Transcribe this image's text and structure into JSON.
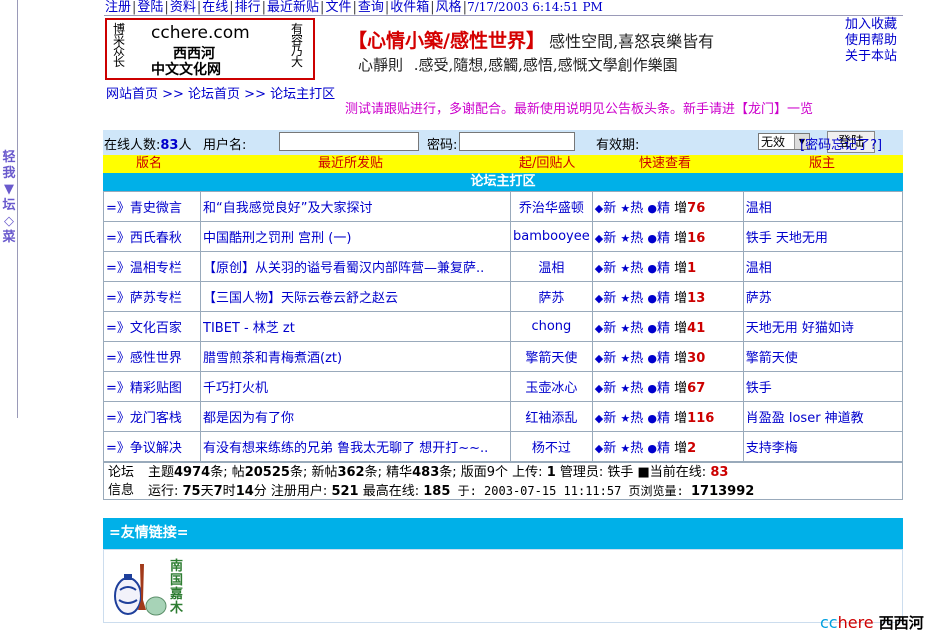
{
  "sidebar": {
    "label": "轻我▼坛◇菜"
  },
  "topnav": {
    "items": [
      "注册",
      "登陆",
      "资料",
      "在线",
      "排行",
      "最近新贴",
      "文件",
      "查询",
      "收件箱",
      "风格"
    ],
    "datetime": "7/17/2003 6:14:51 PM"
  },
  "logo": {
    "left_chars": "博采众长",
    "right_chars": "有容乃大",
    "site": "cchere.com",
    "sub1": "西西河",
    "sub2": "中文文化网"
  },
  "slogan": {
    "title": "【心情小築/感性世界】",
    "line1_rest": "感性空間,喜怒哀樂皆有",
    "line2": "心靜則 .感受,隨想,感觸,感悟,感慨文學創作樂園"
  },
  "right_links": [
    "加入收藏",
    "使用帮助",
    "关于本站"
  ],
  "breadcrumb": "网站首页 >> 论坛首页 >> 论坛主打区",
  "notice": "测试请跟贴进行，多谢配合。最新使用说明见公告板头条。新手请进【龙门】一览",
  "login": {
    "online_prefix": "在线人数:",
    "online_count": "83",
    "online_suffix": "人",
    "username_label": "用户名:",
    "username_value": "",
    "password_label": "密码:",
    "password_value": "",
    "validity_label": "有效期:",
    "validity_value": "无效",
    "submit_label": "登陆",
    "forgot_label": "[密码忘记了?]"
  },
  "columns": [
    "版名",
    "最近所发贴",
    "起/回贴人",
    "快速查看",
    "版主"
  ],
  "section_title": "论坛主打区",
  "quickview": {
    "new": "新",
    "hot": "热",
    "best": "精",
    "inc": "增"
  },
  "forums": [
    {
      "name": "=》青史微言",
      "post": "和“自我感觉良好”及大家探讨",
      "user": "乔治华盛顿",
      "inc": "76",
      "mods": "温相"
    },
    {
      "name": "=》西氏春秋",
      "post": "中国酷刑之罚刑 宫刑 (一)",
      "user": "bambooyee",
      "inc": "16",
      "mods": "铁手 天地无用"
    },
    {
      "name": "=》温相专栏",
      "post": "【原创】从关羽的谥号看蜀汉内部阵营—兼复萨..",
      "user": "温相",
      "inc": "1",
      "mods": "温相"
    },
    {
      "name": "=》萨苏专栏",
      "post": "【三国人物】天际云卷云舒之赵云",
      "user": "萨苏",
      "inc": "13",
      "mods": "萨苏"
    },
    {
      "name": "=》文化百家",
      "post": "TIBET - 林芝 zt",
      "user": "chong",
      "inc": "41",
      "mods": "天地无用 好猫如诗"
    },
    {
      "name": "=》感性世界",
      "post": "腊雪煎茶和青梅煮酒(zt)",
      "user": "擎箭天使",
      "inc": "30",
      "mods": "擎箭天使"
    },
    {
      "name": "=》精彩贴图",
      "post": "千巧打火机",
      "user": "玉壶冰心",
      "inc": "67",
      "mods": "铁手"
    },
    {
      "name": "=》龙门客栈",
      "post": "都是因为有了你",
      "user": "红袖添乱",
      "inc": "116",
      "mods": "肖盈盈 loser 神道教"
    },
    {
      "name": "=》争议解决",
      "post": "有没有想来练练的兄弟 鲁我太无聊了 想开打~~..",
      "user": "杨不过",
      "inc": "2",
      "mods": "支持李梅"
    }
  ],
  "stats": {
    "label1": "论坛",
    "label2": "信息",
    "line1": {
      "topics_prefix": "主题",
      "topics": "4974",
      "topics_suffix": "条; 帖",
      "posts": "20525",
      "posts_suffix": "条; 新帖",
      "new": "362",
      "new_suffix": "条; 精华",
      "best": "483",
      "best_suffix": "条; 版面9个 上传: ",
      "uploads": "1",
      "admin_text": " 管理员: 铁手 ■当前在线: ",
      "online": "83"
    },
    "line2": {
      "run_prefix": "运行: ",
      "run_days": "75",
      "run_days_suffix": "天",
      "run_hours": "7",
      "run_hours_suffix": "时",
      "run_min": "14",
      "run_min_suffix": "分 注册用户: ",
      "users": "521",
      "peak_prefix": " 最高在线: ",
      "peak": "185",
      "peak_date": " 于: 2003-07-15 11:11:57 页浏览量: ",
      "pageviews": "1713992"
    }
  },
  "friend_links": {
    "title": "=友情链接=",
    "partner_label": "南国嘉木"
  },
  "footer": {
    "cc": "cc",
    "here": "here",
    "name": "西西河"
  }
}
